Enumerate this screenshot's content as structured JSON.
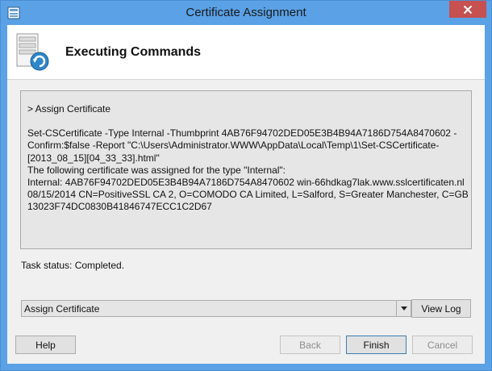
{
  "window": {
    "title": "Certificate Assignment"
  },
  "header": {
    "title": "Executing Commands"
  },
  "log": {
    "heading": "> Assign Certificate",
    "lines": [
      "Set-CSCertificate -Type Internal -Thumbprint 4AB76F94702DED05E3B4B94A7186D754A8470602 -",
      "Confirm:$false -Report \"C:\\Users\\Administrator.WWW\\AppData\\Local\\Temp\\1\\Set-CSCertificate-",
      "[2013_08_15][04_33_33].html\"",
      "The following certificate was assigned for the type \"Internal\":",
      "Internal: 4AB76F94702DED05E3B4B94A7186D754A8470602 win-66hdkag7lak.www.sslcertificaten.nl",
      "08/15/2014 CN=PositiveSSL CA 2, O=COMODO CA Limited, L=Salford, S=Greater Manchester, C=GB",
      "13023F74DC0830B41846747ECC1C2D67"
    ]
  },
  "status": {
    "text": "Task status: Completed."
  },
  "task_select": {
    "value": "Assign Certificate"
  },
  "buttons": {
    "view_log": "View Log",
    "help": "Help",
    "back": "Back",
    "finish": "Finish",
    "cancel": "Cancel"
  },
  "icons": {
    "app": "app-icon",
    "close": "close-icon",
    "header": "server-refresh-icon",
    "dropdown": "chevron-down-icon"
  },
  "colors": {
    "title_bar": "#5aa1e6",
    "close_button": "#c75050",
    "log_background": "#e6e6e6"
  }
}
